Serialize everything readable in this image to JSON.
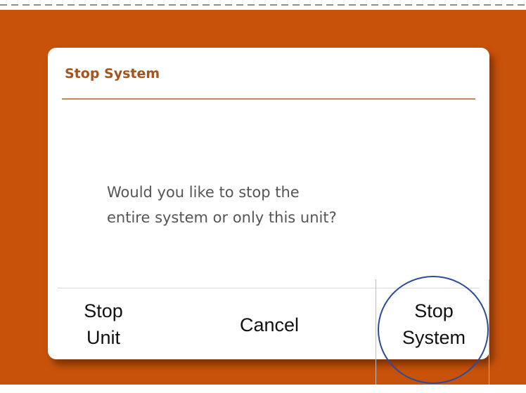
{
  "dialog": {
    "title": "Stop System",
    "message_line1": "Would you like to stop the",
    "message_line2": "entire system or only this unit?",
    "actions": {
      "stop_unit_line1": "Stop",
      "stop_unit_line2": "Unit",
      "cancel": "Cancel",
      "stop_system_line1": "Stop",
      "stop_system_line2": "System"
    }
  },
  "colors": {
    "background": "#c8520a",
    "title": "#a0561e",
    "highlight_circle": "#2d4b99"
  },
  "annotations": {
    "highlight_icon": "circle-highlight"
  }
}
